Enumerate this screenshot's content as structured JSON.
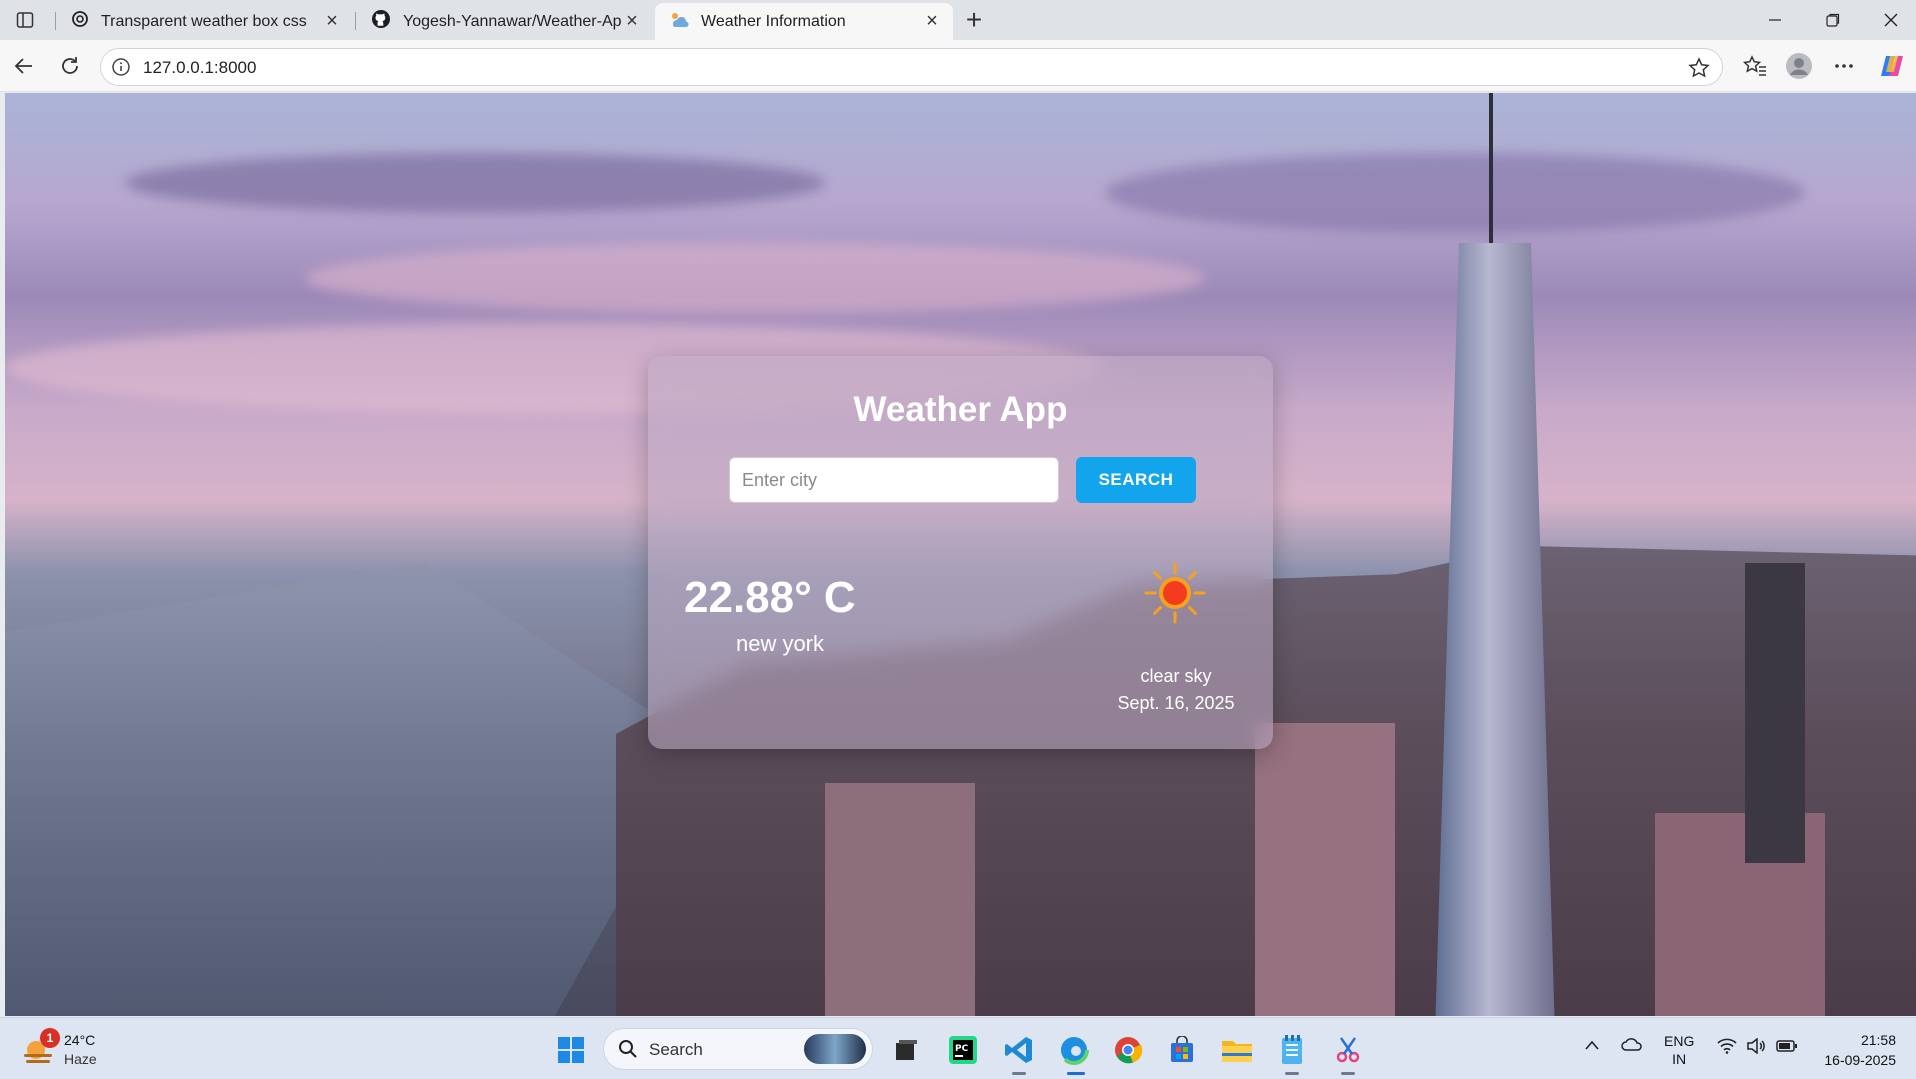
{
  "browser": {
    "tabs": [
      {
        "title": "Transparent weather box css",
        "icon": "openai-icon",
        "active": false
      },
      {
        "title": "Yogesh-Yannawar/Weather-App-D",
        "icon": "github-icon",
        "active": false
      },
      {
        "title": "Weather Information",
        "icon": "weather-favicon",
        "active": true
      }
    ],
    "new_tab_label": "+",
    "address": "127.0.0.1:8000"
  },
  "app": {
    "title": "Weather App",
    "search": {
      "placeholder": "Enter city",
      "value": "",
      "button_label": "SEARCH"
    },
    "temperature": "22.88° C",
    "city": "new york",
    "description": "clear sky",
    "date": "Sept. 16, 2025",
    "weather_icon": "sun-icon"
  },
  "taskbar": {
    "weather": {
      "temp": "24°C",
      "condition": "Haze",
      "badge": "1"
    },
    "search_label": "Search",
    "language": {
      "line1": "ENG",
      "line2": "IN"
    },
    "clock": {
      "time": "21:58",
      "date": "16-09-2025"
    },
    "apps": [
      "windows-start-icon",
      "search-icon",
      "task-view-icon",
      "pycharm-icon",
      "vscode-icon",
      "edge-icon",
      "chrome-icon",
      "store-icon",
      "file-explorer-icon",
      "notepad-icon",
      "snipping-tool-icon"
    ]
  }
}
